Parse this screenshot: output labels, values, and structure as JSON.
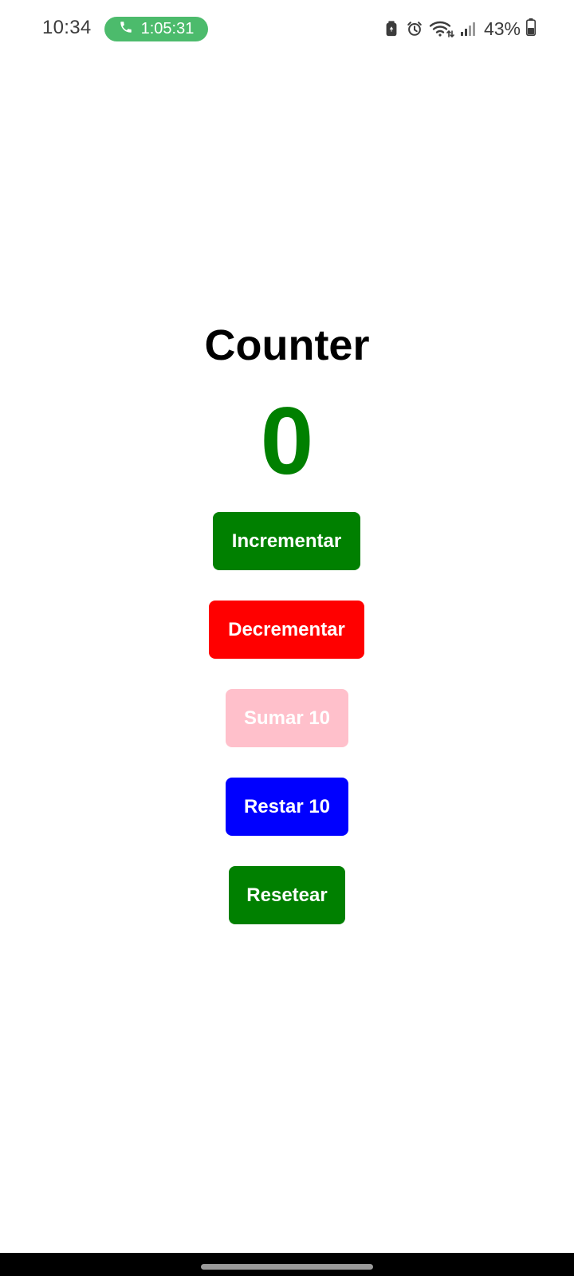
{
  "status_bar": {
    "time": "10:34",
    "call_timer": "1:05:31",
    "battery_percent": "43%",
    "icons": [
      "phone-icon",
      "recycle-icon",
      "alarm-icon",
      "wifi-icon",
      "signal-icon",
      "battery-icon"
    ]
  },
  "counter": {
    "title": "Counter",
    "value": "0"
  },
  "buttons": {
    "increment": "Incrementar",
    "decrement": "Decrementar",
    "add10": "Sumar 10",
    "sub10": "Restar 10",
    "reset": "Resetear"
  },
  "colors": {
    "count_value": "#008000",
    "call_chip": "#4cbb6c",
    "increment": "#008000",
    "decrement": "#ff0000",
    "add10": "#ffc0cb",
    "sub10": "#0000ff",
    "reset": "#008000"
  }
}
